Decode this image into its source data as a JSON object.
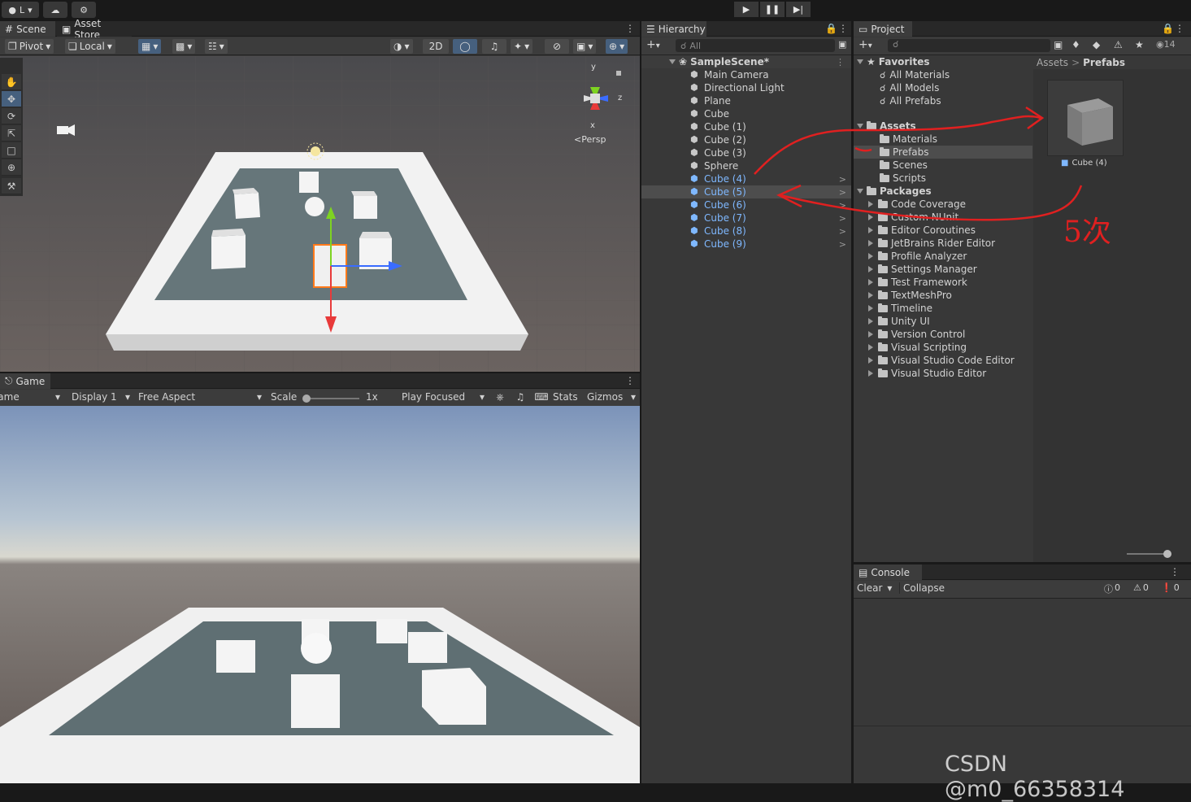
{
  "topbar": {
    "account": "L",
    "cloud_icon": "cloud-icon",
    "collab_icon": "gear-icon"
  },
  "scene": {
    "tab_scene": "Scene",
    "tab_asset_store": "Asset Store",
    "pivot": "Pivot",
    "local": "Local",
    "mode_2d": "2D",
    "persp": "Persp",
    "gizmo_y": "y",
    "gizmo_x": "x",
    "gizmo_z": "z"
  },
  "game": {
    "tab": "Game",
    "view_select": "Game",
    "display": "Display 1",
    "aspect": "Free Aspect",
    "scale_label": "Scale",
    "scale_value": "1x",
    "play_mode": "Play Focused",
    "stats": "Stats",
    "gizmos": "Gizmos"
  },
  "hierarchy": {
    "tab": "Hierarchy",
    "search_placeholder": "All",
    "scene_name": "SampleScene*",
    "items": [
      {
        "label": "Main Camera",
        "prefab": false
      },
      {
        "label": "Directional Light",
        "prefab": false
      },
      {
        "label": "Plane",
        "prefab": false
      },
      {
        "label": "Cube",
        "prefab": false
      },
      {
        "label": "Cube (1)",
        "prefab": false
      },
      {
        "label": "Cube (2)",
        "prefab": false
      },
      {
        "label": "Cube (3)",
        "prefab": false
      },
      {
        "label": "Sphere",
        "prefab": false
      },
      {
        "label": "Cube (4)",
        "prefab": true
      },
      {
        "label": "Cube (5)",
        "prefab": true
      },
      {
        "label": "Cube (6)",
        "prefab": true
      },
      {
        "label": "Cube (7)",
        "prefab": true
      },
      {
        "label": "Cube (8)",
        "prefab": true
      },
      {
        "label": "Cube (9)",
        "prefab": true
      }
    ]
  },
  "project": {
    "tab": "Project",
    "badge_count": "14",
    "favorites": "Favorites",
    "fav_items": [
      "All Materials",
      "All Models",
      "All Prefabs"
    ],
    "assets": "Assets",
    "asset_folders": [
      "Materials",
      "Prefabs",
      "Scenes",
      "Scripts"
    ],
    "packages": "Packages",
    "package_folders": [
      "Code Coverage",
      "Custom NUnit",
      "Editor Coroutines",
      "JetBrains Rider Editor",
      "Profile Analyzer",
      "Settings Manager",
      "Test Framework",
      "TextMeshPro",
      "Timeline",
      "Unity UI",
      "Version Control",
      "Visual Scripting",
      "Visual Studio Code Editor",
      "Visual Studio Editor"
    ],
    "breadcrumb_root": "Assets",
    "breadcrumb_current": "Prefabs",
    "asset_name": "Cube (4)"
  },
  "console": {
    "tab": "Console",
    "clear": "Clear",
    "collapse": "Collapse",
    "info_count": "0",
    "warn_count": "0",
    "error_count": "0"
  },
  "annotation": {
    "text": "5次",
    "color": "#e02020"
  },
  "watermark": "CSDN @m0_66358314",
  "colors": {
    "prefab_blue": "#7fb8ff",
    "selection": "#4d4d4d",
    "panel": "#383838"
  }
}
